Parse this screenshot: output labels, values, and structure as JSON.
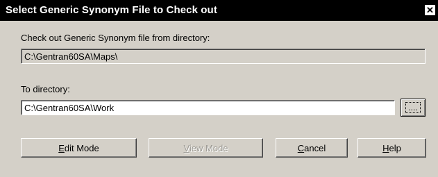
{
  "window": {
    "title": "Select Generic Synonym File to Check out",
    "close_glyph": "✕",
    "icon_names": {
      "close": "close-icon"
    }
  },
  "from_section": {
    "label": "Check out Generic Synonym file from directory:",
    "value": "C:\\Gentran60SA\\Maps\\"
  },
  "to_section": {
    "label": "To directory:",
    "value": "C:\\Gentran60SA\\Work",
    "browse_label": "...."
  },
  "buttons": {
    "edit_mode": {
      "mnemonic": "E",
      "rest": "dit Mode"
    },
    "view_mode": {
      "mnemonic": "V",
      "rest": "iew Mode"
    },
    "cancel": {
      "mnemonic": "C",
      "rest": "ancel"
    },
    "help": {
      "mnemonic": "H",
      "rest": "elp"
    }
  },
  "colors": {
    "titlebar": "#000000",
    "dialog_bg": "#d4d0c8",
    "field_white": "#ffffff"
  }
}
